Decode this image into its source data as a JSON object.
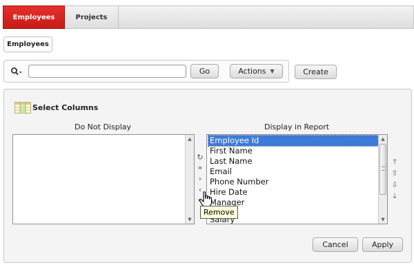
{
  "tabs": [
    {
      "label": "Employees",
      "active": true
    },
    {
      "label": "Projects",
      "active": false
    }
  ],
  "breadcrumb": "Employees",
  "search": {
    "icon": "search-icon",
    "value": "",
    "go_label": "Go",
    "actions_label": "Actions",
    "create_label": "Create"
  },
  "select_columns": {
    "title": "Select Columns",
    "left_heading": "Do Not Display",
    "right_heading": "Display in Report",
    "left_items": [],
    "right_items": [
      {
        "label": "Employee Id",
        "selected": true
      },
      {
        "label": "First Name"
      },
      {
        "label": "Last Name"
      },
      {
        "label": "Email"
      },
      {
        "label": "Phone Number"
      },
      {
        "label": "Hire Date"
      },
      {
        "label": "Manager"
      },
      {
        "label": "Salary"
      }
    ],
    "cancel_label": "Cancel",
    "apply_label": "Apply"
  },
  "tooltip": "Remove",
  "colors": {
    "active_tab": "#d6221c",
    "selection": "#3d7bd9",
    "tooltip_bg": "#ffffdc"
  }
}
